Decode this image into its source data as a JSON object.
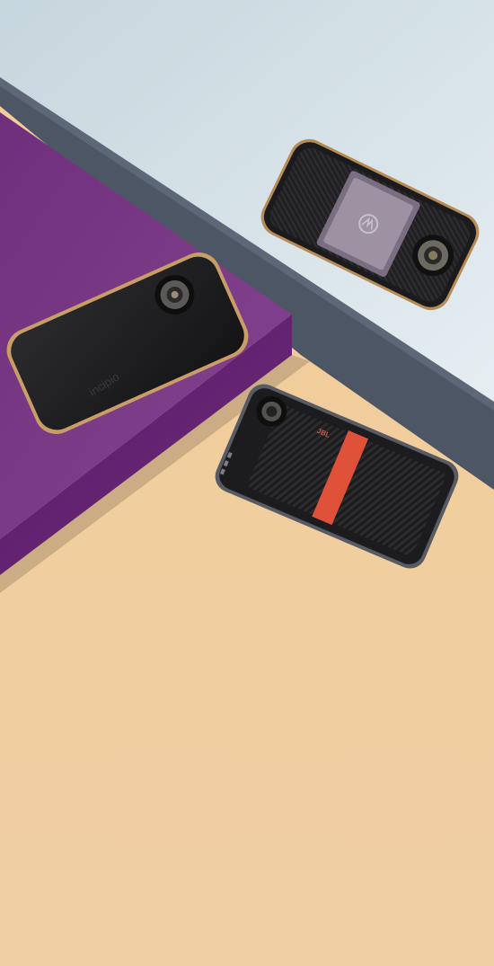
{
  "scene": {
    "description_alt": "",
    "colors": {
      "light_blue_surface": "#d7e3e9",
      "slate_ledge": "#4e5766",
      "purple_block": "#7a3a85",
      "peach_floor": "#f1cd9e",
      "phone_black": "#1f1f21",
      "gold_trim": "#c79a63",
      "red_band": "#e0513a"
    }
  },
  "devices": [
    {
      "id": "speaker-mod-top",
      "icon": "motorola-logo-icon",
      "label": ""
    },
    {
      "id": "battery-mod-left",
      "brand_text": "incipio"
    },
    {
      "id": "jbl-speaker-mod-bottom",
      "brand_text": "JBL"
    }
  ]
}
